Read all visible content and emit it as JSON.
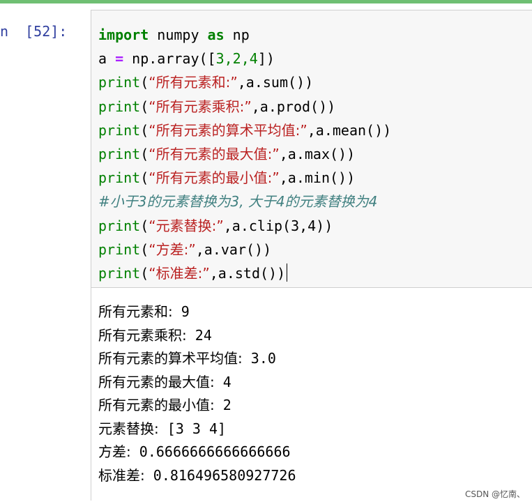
{
  "cell": {
    "prompt": "n  [52]:",
    "code_lines": [
      {
        "k1": "import",
        "t1": " numpy ",
        "k2": "as",
        "t2": " np"
      },
      {
        "t1": "a ",
        "op": "=",
        "t2": " np.array([",
        "nums": "3,2,4",
        "t3": "])"
      },
      {
        "fn": "print",
        "p1": "(",
        "s": "“所有元素和:”",
        "t": ",a.sum())"
      },
      {
        "fn": "print",
        "p1": "(",
        "s": "“所有元素乘积:”",
        "t": ",a.prod())"
      },
      {
        "fn": "print",
        "p1": "(",
        "s": "“所有元素的算术平均值:”",
        "t": ",a.mean())"
      },
      {
        "fn": "print",
        "p1": "(",
        "s": "“所有元素的最大值:”",
        "t": ",a.max())"
      },
      {
        "fn": "print",
        "p1": "(",
        "s": "“所有元素的最小值:”",
        "t": ",a.min())"
      },
      {
        "comment": "#小于3的元素替换为3, 大于4的元素替换为4"
      },
      {
        "fn": "print",
        "p1": "(",
        "s": "“元素替换:”",
        "t": ",a.clip(3,4))"
      },
      {
        "fn": "print",
        "p1": "(",
        "s": "“方差:”",
        "t": ",a.var())"
      },
      {
        "fn": "print",
        "p1": "(",
        "s": "“标准差:”",
        "t": ",a.std())"
      }
    ],
    "output_lines": [
      {
        "label": "所有元素和:",
        "value": " 9"
      },
      {
        "label": "所有元素乘积:",
        "value": " 24"
      },
      {
        "label": "所有元素的算术平均值:",
        "value": " 3.0"
      },
      {
        "label": "所有元素的最大值:",
        "value": " 4"
      },
      {
        "label": "所有元素的最小值:",
        "value": " 2"
      },
      {
        "label": "元素替换:",
        "value": " [3 3 4]"
      },
      {
        "label": "方差:",
        "value": " 0.6666666666666666"
      },
      {
        "label": "标准差:",
        "value": " 0.816496580927726"
      }
    ]
  },
  "watermark": "CSDN @忆南、",
  "colors": {
    "keyword": "#008000",
    "string": "#ba2121",
    "comment": "#408080",
    "operator": "#aa22ff",
    "prompt": "#303f9f"
  }
}
